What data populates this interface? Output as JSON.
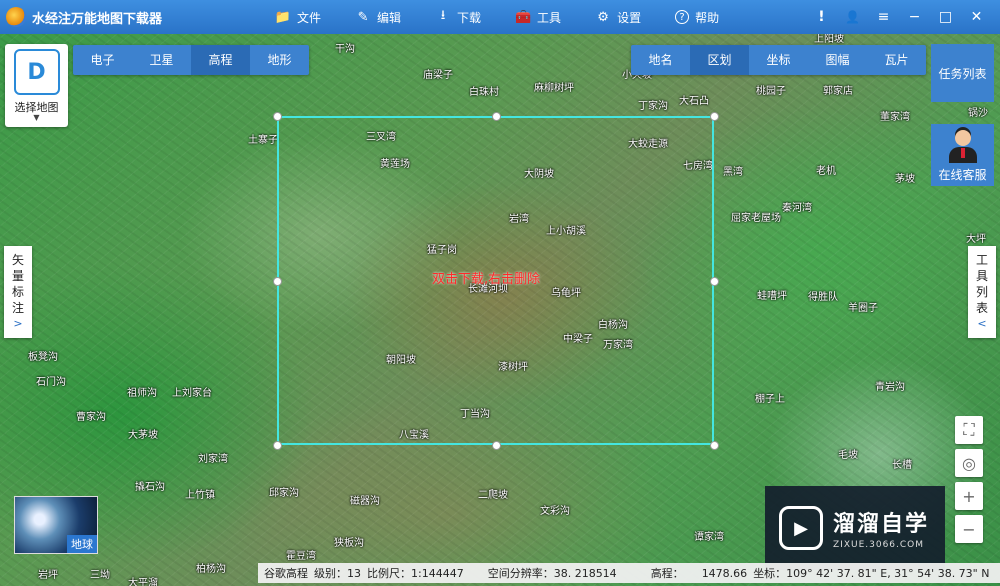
{
  "app": {
    "title": "水经注万能地图下载器"
  },
  "menu": [
    {
      "label": "文件",
      "icon": "folder-icon",
      "glyph": "📁"
    },
    {
      "label": "编辑",
      "icon": "edit-icon",
      "glyph": "✎"
    },
    {
      "label": "下载",
      "icon": "download-icon",
      "glyph": "⭳"
    },
    {
      "label": "工具",
      "icon": "toolbox-icon",
      "glyph": "🧰"
    },
    {
      "label": "设置",
      "icon": "settings-icon",
      "glyph": "⚙"
    },
    {
      "label": "帮助",
      "icon": "help-icon",
      "glyph": "?"
    }
  ],
  "window_controls": {
    "info": "!",
    "user": "👤",
    "menu": "≡",
    "minimize": "−",
    "maximize": "□",
    "close": "✕"
  },
  "choose_map": {
    "label": "选择地图",
    "logo": "D"
  },
  "map_type_tabs": [
    "电子",
    "卫星",
    "高程",
    "地形"
  ],
  "map_type_active": "高程",
  "overlay_tabs": [
    "地名",
    "区划",
    "坐标",
    "图幅",
    "瓦片"
  ],
  "overlay_active": "区划",
  "task_list": {
    "label": "任务列表"
  },
  "online_service": {
    "label": "在线客服"
  },
  "vector_tab": {
    "label": "矢\n量\n标\n注",
    "chars": [
      "矢",
      "量",
      "标",
      "注"
    ],
    "arrow": ">"
  },
  "tool_tab": {
    "chars": [
      "工",
      "具",
      "列",
      "表"
    ],
    "arrow": "<"
  },
  "selection": {
    "hint": "双击下载,右击删除"
  },
  "tools": {
    "fullscreen": "⛶",
    "locate": "◎",
    "zoom_in": "+",
    "zoom_out": "−"
  },
  "earth": {
    "label": "地球"
  },
  "watermark": {
    "main": "溜溜自学",
    "sub": "ZIXUE.3066.COM",
    "play": "▶"
  },
  "status": {
    "layer": "谷歌高程",
    "level": "级别：13",
    "scale": "比例尺：1:144447",
    "resolution": "空间分辨率：38. 218514",
    "elevation_label": "高程：",
    "elevation": "1478.66",
    "coords": "坐标：109° 42' 37. 81\" E, 31° 54' 38. 73\" N"
  },
  "places": [
    {
      "name": "干沟"
    },
    {
      "name": "庙梁子"
    },
    {
      "name": "白珠村"
    },
    {
      "name": "麻柳树坪"
    },
    {
      "name": "小天坡"
    },
    {
      "name": "丁家沟"
    },
    {
      "name": "大石凸"
    },
    {
      "name": "桃园子"
    },
    {
      "name": "郭家店"
    },
    {
      "name": "董家湾"
    },
    {
      "name": "土寨子"
    },
    {
      "name": "三叉湾"
    },
    {
      "name": "大蛟走源"
    },
    {
      "name": "黄莲场"
    },
    {
      "name": "七房湾"
    },
    {
      "name": "黑湾"
    },
    {
      "name": "老机"
    },
    {
      "name": "茅坡"
    },
    {
      "name": "大阴坡"
    },
    {
      "name": "秦河湾"
    },
    {
      "name": "屈家老屋场"
    },
    {
      "name": "岩湾"
    },
    {
      "name": "上小胡溪"
    },
    {
      "name": "猛子岗"
    },
    {
      "name": "长滩河坝"
    },
    {
      "name": "乌龟坪"
    },
    {
      "name": "蛙嘈坪"
    },
    {
      "name": "得胜队"
    },
    {
      "name": "羊圈子"
    },
    {
      "name": "白杨沟"
    },
    {
      "name": "中梁子"
    },
    {
      "name": "万家湾"
    },
    {
      "name": "板凳沟"
    },
    {
      "name": "朝阳坡"
    },
    {
      "name": "漆树坪"
    },
    {
      "name": "石门沟"
    },
    {
      "name": "祖师沟"
    },
    {
      "name": "上刘家台"
    },
    {
      "name": "青岩沟"
    },
    {
      "name": "棚子上"
    },
    {
      "name": "曹家沟"
    },
    {
      "name": "丁当沟"
    },
    {
      "name": "大茅坡"
    },
    {
      "name": "八宝溪"
    },
    {
      "name": "毛坡"
    },
    {
      "name": "刘家湾"
    },
    {
      "name": "长槽"
    },
    {
      "name": "撬石沟"
    },
    {
      "name": "上竹镇"
    },
    {
      "name": "邱家沟"
    },
    {
      "name": "磁器沟"
    },
    {
      "name": "二爬坡"
    },
    {
      "name": "文彩沟"
    },
    {
      "name": "谭家湾"
    },
    {
      "name": "狭板沟"
    },
    {
      "name": "霍豆湾"
    },
    {
      "name": "柏杨沟"
    },
    {
      "name": "岩坪"
    },
    {
      "name": "三坳"
    },
    {
      "name": "大平溜"
    },
    {
      "name": "上阳坡"
    },
    {
      "name": "大坪"
    },
    {
      "name": "锅沙"
    }
  ]
}
